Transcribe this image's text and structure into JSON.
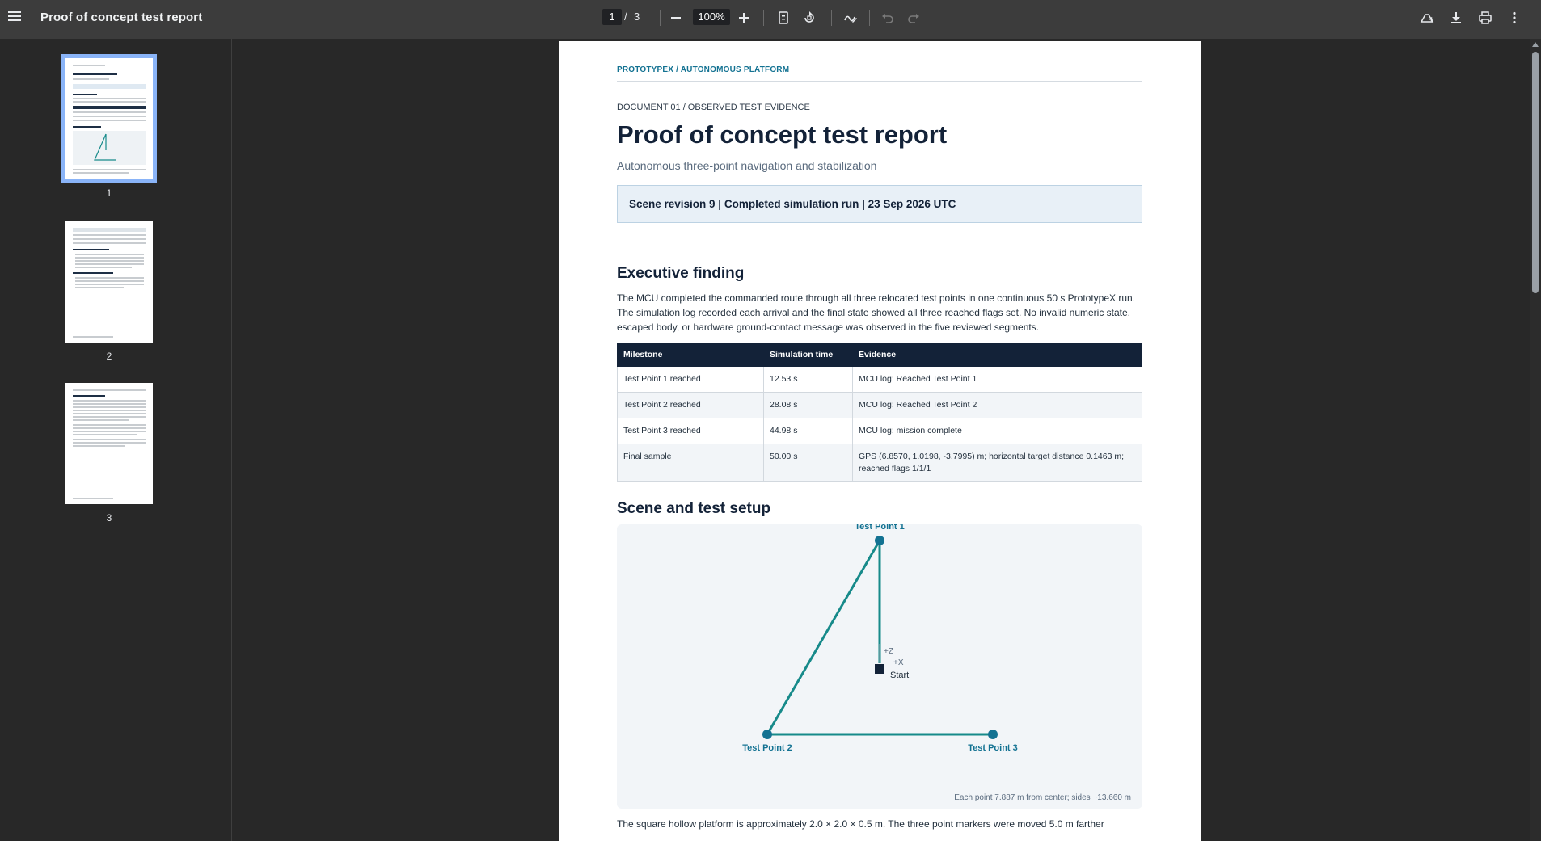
{
  "toolbar": {
    "title": "Proof of concept test report",
    "current_page": "1",
    "page_separator": "/",
    "total_pages": "3",
    "zoom": "100%"
  },
  "sidebar": {
    "thumbnails": [
      {
        "label": "1",
        "selected": true
      },
      {
        "label": "2",
        "selected": false
      },
      {
        "label": "3",
        "selected": false
      }
    ]
  },
  "document": {
    "brand": "PROTOTYPEX / AUTONOMOUS PLATFORM",
    "kicker": "DOCUMENT 01 / OBSERVED TEST EVIDENCE",
    "title": "Proof of concept test report",
    "subtitle": "Autonomous three-point navigation and stabilization",
    "banner": "Scene revision 9 | Completed simulation run | 23 Sep 2026 UTC",
    "executive_heading": "Executive finding",
    "executive_text": "The MCU completed the commanded route through all three relocated test points in one continuous 50 s PrototypeX run. The simulation log recorded each arrival and the final state showed all three reached flags set. No invalid numeric state, escaped body, or hardware ground-contact message was observed in the five reviewed segments.",
    "table": {
      "headers": [
        "Milestone",
        "Simulation time",
        "Evidence"
      ],
      "rows": [
        [
          "Test Point 1 reached",
          "12.53 s",
          "MCU log: Reached Test Point 1"
        ],
        [
          "Test Point 2 reached",
          "28.08 s",
          "MCU log: Reached Test Point 2"
        ],
        [
          "Test Point 3 reached",
          "44.98 s",
          "MCU log: mission complete"
        ],
        [
          "Final sample",
          "50.00 s",
          "GPS (6.8570, 1.0198, -3.7995) m; horizontal target distance 0.1463 m; reached flags 1/1/1"
        ]
      ]
    },
    "scene_heading": "Scene and test setup",
    "diagram": {
      "tp1": "Test Point 1",
      "tp2": "Test Point 2",
      "tp3": "Test Point 3",
      "axis_z": "+Z",
      "axis_x": "+X",
      "start": "Start",
      "caption": "Each point 7.887 m from center; sides ~13.660 m",
      "route_color": "#178a8a",
      "point_color": "#137292"
    },
    "scene_text": "The square hollow platform is approximately 2.0 × 2.0 × 0.5 m. The three point markers were moved 5.0 m farther"
  },
  "colors": {
    "toolbar_bg": "#3c3c3c",
    "viewer_bg": "#282828",
    "heading": "#132238",
    "accent": "#137292",
    "thumb_selected": "#8ab4f8"
  }
}
